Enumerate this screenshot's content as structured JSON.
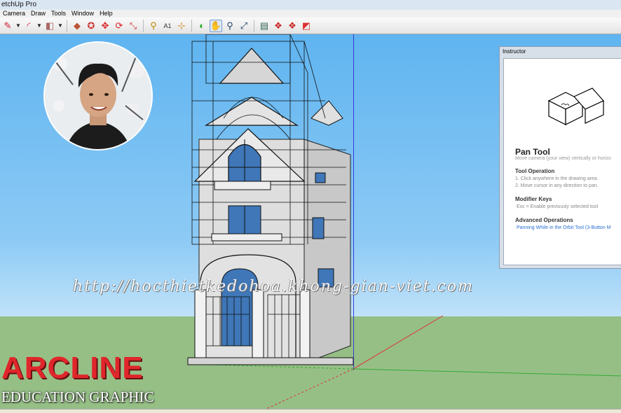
{
  "window": {
    "title": "etchUp Pro"
  },
  "menu": [
    "Camera",
    "Draw",
    "Tools",
    "Window",
    "Help"
  ],
  "toolbar": {
    "tools": [
      {
        "name": "pencil-icon",
        "glyph": "✎",
        "color": "#c23"
      },
      {
        "name": "arc-icon",
        "glyph": "◜",
        "color": "#c23"
      },
      {
        "name": "paint-bucket-icon",
        "glyph": "◧",
        "color": "#a66"
      },
      {
        "name": "push-pull-icon",
        "glyph": "◆",
        "color": "#b53"
      },
      {
        "name": "follow-me-icon",
        "glyph": "✪",
        "color": "#c33"
      },
      {
        "name": "move-icon",
        "glyph": "✥",
        "color": "#d22"
      },
      {
        "name": "rotate-icon",
        "glyph": "⟳",
        "color": "#d22"
      },
      {
        "name": "scale-icon",
        "glyph": "⤡",
        "color": "#c33"
      },
      {
        "name": "tape-measure-icon",
        "glyph": "⚲",
        "color": "#b80"
      },
      {
        "name": "text-icon",
        "glyph": "A1",
        "color": "#333"
      },
      {
        "name": "axes-icon",
        "glyph": "⊹",
        "color": "#c70"
      },
      {
        "name": "orbit-icon",
        "glyph": "◐",
        "color": "#2a2"
      },
      {
        "name": "pan-icon",
        "glyph": "✋",
        "color": "#333"
      },
      {
        "name": "zoom-icon",
        "glyph": "⚲",
        "color": "#246"
      },
      {
        "name": "zoom-extents-icon",
        "glyph": "⤢",
        "color": "#246"
      },
      {
        "name": "components-icon",
        "glyph": "▤",
        "color": "#365"
      },
      {
        "name": "warehouse-icon",
        "glyph": "❖",
        "color": "#c22"
      },
      {
        "name": "share-model-icon",
        "glyph": "❖",
        "color": "#c22"
      },
      {
        "name": "extension-icon",
        "glyph": "◩",
        "color": "#d33"
      }
    ]
  },
  "watermark": "http://hocthietkedohoa.khong-gian-viet.com",
  "brand": {
    "name": "ARCLINE",
    "tagline": "EDUCATION GRAPHIC"
  },
  "instructor": {
    "panel_title": "Instructor",
    "tool_name": "Pan Tool",
    "tool_desc": "Move camera (your view) vertically or horizo",
    "op_heading": "Tool Operation",
    "ops": [
      "1.   Click anywhere in the drawing area.",
      "2.   Move cursor in any direction to pan."
    ],
    "mod_heading": "Modifier Keys",
    "mod_text": "Esc = Enable previously selected tool",
    "adv_heading": "Advanced Operations",
    "adv_link": "Panning While in the Orbit Tool (3-Button M"
  },
  "colors": {
    "sky": "#5fb4f0",
    "ground": "#96bf86",
    "brand_red": "#e0262b",
    "link": "#2a6fd0"
  }
}
